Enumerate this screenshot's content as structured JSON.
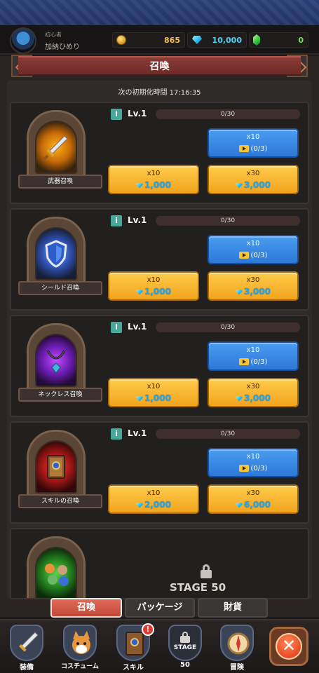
{
  "player": {
    "rank": "初心者",
    "name": "加納ひめり"
  },
  "currency": {
    "gold": "865",
    "gems": "10,000",
    "green": "0"
  },
  "corner_marker": "%",
  "title": "召喚",
  "reset_label": "次の初期化時間 17:16:35",
  "cards": [
    {
      "name": "武器召喚",
      "icon": "sword-icon",
      "level": "Lv.1",
      "progress": "0/30",
      "progress_fraction": 0,
      "ad_button": {
        "top": "x10",
        "bottom": "(0/3)"
      },
      "buy10": {
        "top": "x10",
        "price": "1,000"
      },
      "buy30": {
        "top": "x30",
        "price": "3,000"
      }
    },
    {
      "name": "シールド召喚",
      "icon": "shield-icon",
      "level": "Lv.1",
      "progress": "0/30",
      "progress_fraction": 0,
      "ad_button": {
        "top": "x10",
        "bottom": "(0/3)"
      },
      "buy10": {
        "top": "x10",
        "price": "1,000"
      },
      "buy30": {
        "top": "x30",
        "price": "3,000"
      }
    },
    {
      "name": "ネックレス召喚",
      "icon": "necklace-icon",
      "level": "Lv.1",
      "progress": "0/30",
      "progress_fraction": 0,
      "ad_button": {
        "top": "x10",
        "bottom": "(0/3)"
      },
      "buy10": {
        "top": "x10",
        "price": "1,000"
      },
      "buy30": {
        "top": "x30",
        "price": "3,000"
      }
    },
    {
      "name": "スキルの召喚",
      "icon": "skill-book-icon",
      "level": "Lv.1",
      "progress": "0/30",
      "progress_fraction": 0,
      "ad_button": {
        "top": "x10",
        "bottom": "(0/3)"
      },
      "buy10": {
        "top": "x10",
        "price": "2,000"
      },
      "buy30": {
        "top": "x30",
        "price": "6,000"
      }
    }
  ],
  "locked_card": {
    "icon": "pets-icon",
    "lock_text": "STAGE 50"
  },
  "tabs": [
    {
      "label": "召喚",
      "active": true
    },
    {
      "label": "パッケージ",
      "active": false
    },
    {
      "label": "財貨",
      "active": false
    }
  ],
  "nav": [
    {
      "label": "装備",
      "icon": "sword-icon"
    },
    {
      "label": "コスチューム",
      "icon": "shiba-dog-icon"
    },
    {
      "label": "スキル",
      "icon": "skill-book-icon",
      "badge": "!"
    },
    {
      "label": "STAGE",
      "sub": "50",
      "icon": "lock-icon"
    },
    {
      "label": "冒険",
      "icon": "compass-icon"
    }
  ],
  "close_icon": "close-icon",
  "colors": {
    "accent_red": "#c3483a",
    "gold_button": "#f2a51e",
    "blue_button": "#2c78d8",
    "gem_text": "#2aa6e6"
  }
}
